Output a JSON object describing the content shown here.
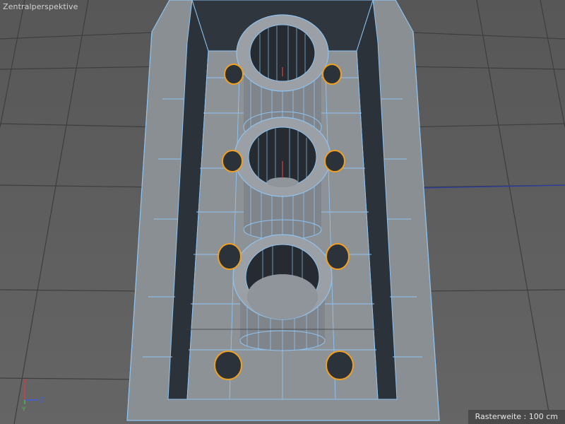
{
  "viewport": {
    "title": "Zentralperspektive",
    "grid_status": "Rasterweite : 100 cm"
  },
  "axis": {
    "x": "X",
    "y": "Y",
    "z": "Z"
  },
  "colors": {
    "background": "#5f5f5f",
    "grid_line": "#3e3e3e",
    "mesh_face": "#8a8f94",
    "mesh_edge": "#8fc3f0",
    "wall_dark": "#2c3239",
    "selection": "#f0a020",
    "axis_x": "#d24040",
    "axis_y": "#40c040",
    "axis_z": "#4060e0"
  }
}
